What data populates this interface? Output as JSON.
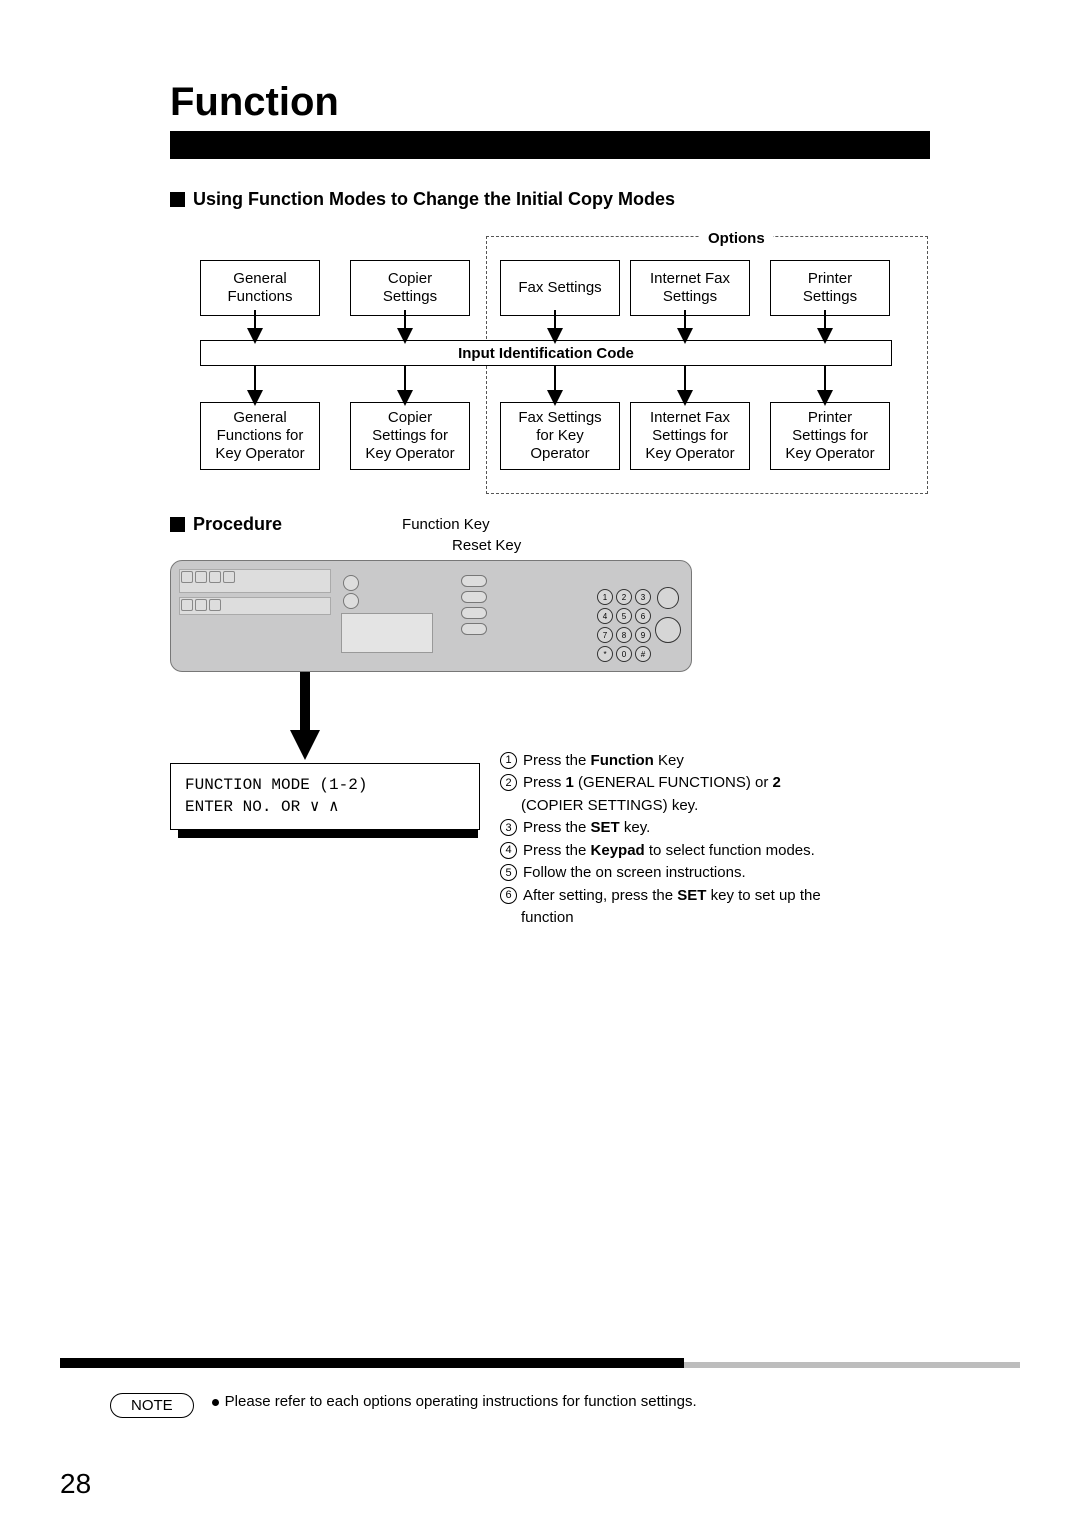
{
  "title": "Function",
  "subheading": "Using Function Modes to Change the Initial Copy Modes",
  "options_label": "Options",
  "flow": {
    "top": [
      "General\nFunctions",
      "Copier\nSettings",
      "Fax Settings",
      "Internet Fax\nSettings",
      "Printer\nSettings"
    ],
    "id_bar": "Input Identification Code",
    "bottom": [
      "General\nFunctions for\nKey Operator",
      "Copier\nSettings for\nKey Operator",
      "Fax Settings\nfor Key\nOperator",
      "Internet Fax\nSettings for\nKey Operator",
      "Printer\nSettings for\nKey Operator"
    ]
  },
  "procedure_label": "Procedure",
  "key_labels": {
    "function": "Function Key",
    "reset": "Reset Key"
  },
  "display": {
    "line1": "FUNCTION MODE  (1-2)",
    "line2": "ENTER NO. OR ∨ ∧"
  },
  "steps": [
    {
      "n": "1",
      "text_before": "Press the ",
      "bold": "Function",
      "text_after": " Key"
    },
    {
      "n": "2",
      "text_before": "Press ",
      "bold": "1",
      "text_after": " (GENERAL FUNCTIONS) or ",
      "bold2": "2",
      "cont": "(COPIER SETTINGS) key."
    },
    {
      "n": "3",
      "text_before": "Press the ",
      "bold": "SET",
      "text_after": " key."
    },
    {
      "n": "4",
      "text_before": "Press the ",
      "bold": "Keypad",
      "text_after": " to select function modes."
    },
    {
      "n": "5",
      "text_before": "Follow the on screen instructions.",
      "bold": "",
      "text_after": ""
    },
    {
      "n": "6",
      "text_before": "After setting, press the ",
      "bold": "SET",
      "text_after": " key to set up the",
      "cont": "function"
    }
  ],
  "note_label": "NOTE",
  "note_text": "Please refer to each options operating instructions for function settings.",
  "page_number": "28",
  "keypad": [
    "1",
    "2",
    "3",
    "4",
    "5",
    "6",
    "7",
    "8",
    "9",
    "*",
    "0",
    "#"
  ]
}
